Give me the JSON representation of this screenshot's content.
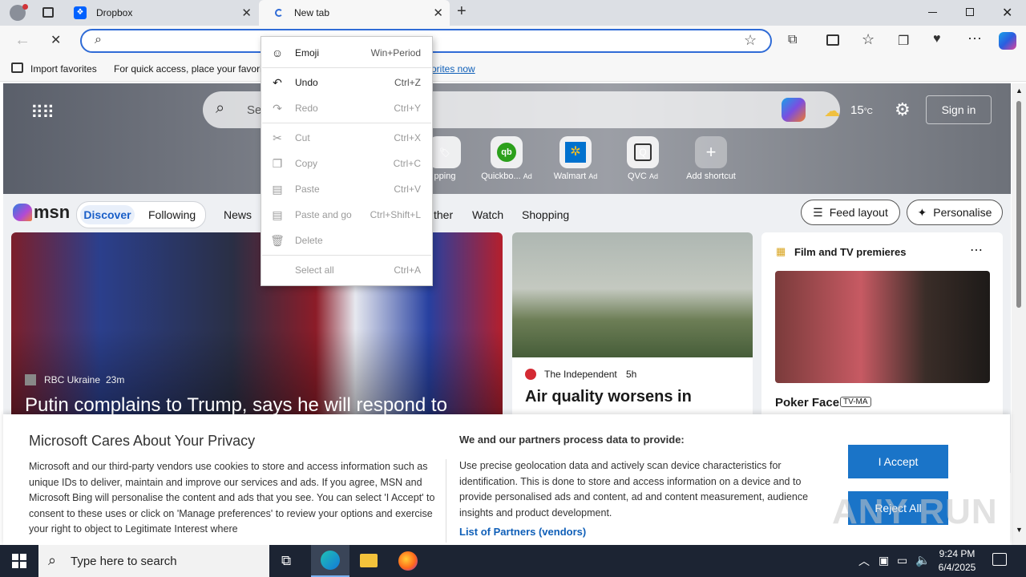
{
  "tabs": [
    {
      "title": "Dropbox"
    },
    {
      "title": "New tab"
    }
  ],
  "address": {
    "value": ""
  },
  "favorites": {
    "import_label": "Import favorites",
    "hint": "For quick access, place your favorit",
    "link_tail": "orites now"
  },
  "context_menu": [
    {
      "label": "Emoji",
      "shortcut": "Win+Period",
      "disabled": false,
      "icon": "emoji-icon"
    },
    {
      "label": "Undo",
      "shortcut": "Ctrl+Z",
      "disabled": false,
      "icon": "undo-icon"
    },
    {
      "label": "Redo",
      "shortcut": "Ctrl+Y",
      "disabled": true,
      "icon": "redo-icon"
    },
    {
      "label": "Cut",
      "shortcut": "Ctrl+X",
      "disabled": true,
      "icon": "cut-icon"
    },
    {
      "label": "Copy",
      "shortcut": "Ctrl+C",
      "disabled": true,
      "icon": "copy-icon"
    },
    {
      "label": "Paste",
      "shortcut": "Ctrl+V",
      "disabled": true,
      "icon": "paste-icon"
    },
    {
      "label": "Paste and go",
      "shortcut": "Ctrl+Shift+L",
      "disabled": true,
      "icon": "paste-go-icon"
    },
    {
      "label": "Delete",
      "shortcut": "",
      "disabled": true,
      "icon": "delete-icon"
    },
    {
      "label": "Select all",
      "shortcut": "Ctrl+A",
      "disabled": true,
      "icon": ""
    }
  ],
  "page": {
    "search_placeholder": "Se",
    "weather": "15",
    "weather_unit": "°C",
    "signin": "Sign in",
    "shortcuts": [
      {
        "label": "pping",
        "ad": ""
      },
      {
        "label": "Quickbo...",
        "ad": "Ad"
      },
      {
        "label": "Walmart",
        "ad": "Ad"
      },
      {
        "label": "QVC",
        "ad": "Ad"
      },
      {
        "label": "Add shortcut",
        "ad": ""
      }
    ],
    "brand": "msn",
    "nav": [
      "Discover",
      "Following",
      "News",
      "ther",
      "Watch",
      "Shopping"
    ],
    "feed_layout": "Feed layout",
    "personalise": "Personalise",
    "main_card": {
      "source": "RBC Ukraine",
      "time": "23m",
      "headline": "Putin complains to Trump, says he will respond to"
    },
    "card2": {
      "source": "The Independent",
      "time": "5h",
      "headline": "Air quality worsens in"
    },
    "card3": {
      "title": "Film and TV premieres",
      "show": "Poker Face",
      "rating": "TV-MA"
    }
  },
  "privacy": {
    "title": "Microsoft Cares About Your Privacy",
    "body": "Microsoft and our third-party vendors use cookies to store and access information such as unique IDs to deliver, maintain and improve our services and ads. If you agree, MSN and Microsoft Bing will personalise the content and ads that you see. You can select 'I Accept' to consent to these uses or click on 'Manage preferences' to review your options and exercise your right to object to Legitimate Interest where",
    "right_title": "We and our partners process data to provide:",
    "right_body": "Use precise geolocation data and actively scan device characteristics for identification. This is done to store and access information on a device and to provide personalised ads and content, ad and content measurement, audience insights and product development.",
    "partners_link": "List of Partners (vendors)",
    "accept": "I Accept",
    "reject": "Reject All"
  },
  "watermark": "ANY RUN",
  "taskbar": {
    "search_placeholder": "Type here to search",
    "time": "9:24 PM",
    "date": "6/4/2025"
  }
}
